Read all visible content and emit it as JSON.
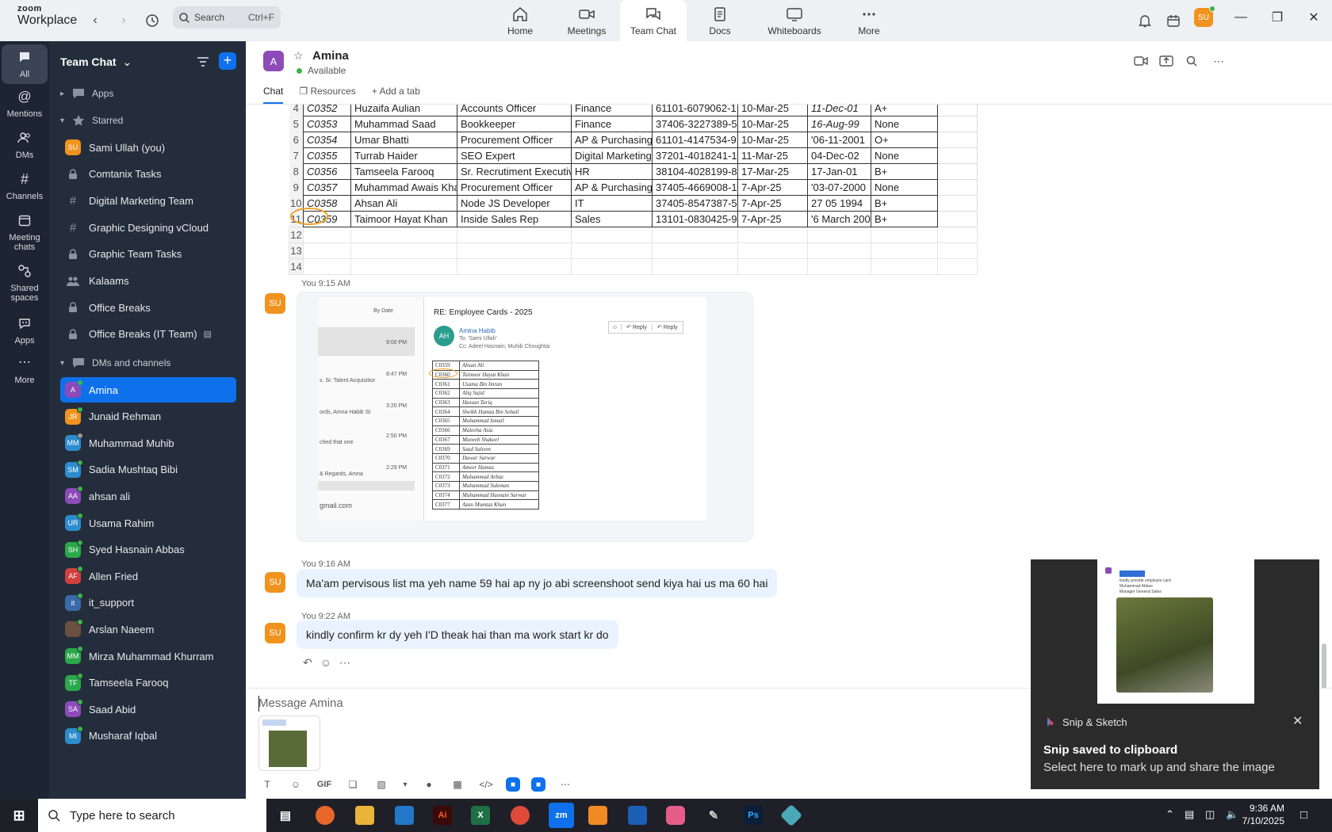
{
  "app": {
    "brand_top": "zoom",
    "brand_bottom": "Workplace"
  },
  "search": {
    "label": "Search",
    "shortcut": "Ctrl+F"
  },
  "nav": [
    {
      "label": "Home"
    },
    {
      "label": "Meetings"
    },
    {
      "label": "Team Chat"
    },
    {
      "label": "Docs"
    },
    {
      "label": "Whiteboards"
    },
    {
      "label": "More"
    }
  ],
  "user": {
    "initials": "SU"
  },
  "rail": [
    {
      "label": "All"
    },
    {
      "label": "Mentions"
    },
    {
      "label": "DMs"
    },
    {
      "label": "Channels"
    },
    {
      "label": "Meeting chats"
    },
    {
      "label": "Shared spaces"
    },
    {
      "label": "Apps"
    },
    {
      "label": "More"
    }
  ],
  "sidebar": {
    "title": "Team Chat",
    "apps_label": "Apps",
    "starred_label": "Starred",
    "dms_label": "DMs and channels",
    "starred": [
      {
        "label": "Sami Ullah (you)",
        "initials": "SU",
        "color": "#f0931e"
      },
      {
        "label": "Comtanix Tasks",
        "icon": "lock"
      },
      {
        "label": "Digital Marketing Team",
        "icon": "#"
      },
      {
        "label": "Graphic Designing vCloud",
        "icon": "#"
      },
      {
        "label": "Graphic Team Tasks",
        "icon": "lock"
      },
      {
        "label": "Kalaams",
        "icon": "group"
      },
      {
        "label": "Office Breaks",
        "icon": "lock"
      },
      {
        "label": "Office Breaks (IT Team)",
        "icon": "lock"
      }
    ],
    "dms": [
      {
        "label": "Amina",
        "initials": "A",
        "color": "#8c4bb8",
        "active": true
      },
      {
        "label": "Junaid Rehman",
        "initials": "JR",
        "color": "#f0931e"
      },
      {
        "label": "Muhammad Muhib",
        "initials": "MM",
        "color": "#2d8cce"
      },
      {
        "label": "Sadia Mushtaq Bibi",
        "initials": "SM",
        "color": "#2d8cce"
      },
      {
        "label": "ahsan ali",
        "initials": "AA",
        "color": "#8c4bb8"
      },
      {
        "label": "Usama Rahim",
        "initials": "UR",
        "color": "#2d8cce"
      },
      {
        "label": "Syed Hasnain Abbas",
        "initials": "SH",
        "color": "#2aa84a"
      },
      {
        "label": "Allen Fried",
        "initials": "AF",
        "color": "#d04040"
      },
      {
        "label": "it_support",
        "initials": "it",
        "color": "#3a6aa8"
      },
      {
        "label": "Arslan Naeem",
        "initials": "",
        "color": "#6b5040"
      },
      {
        "label": "Mirza Muhammad Khurram",
        "initials": "MM",
        "color": "#2aa84a"
      },
      {
        "label": "Tamseela Farooq",
        "initials": "TF",
        "color": "#2aa84a"
      },
      {
        "label": "Saad Abid",
        "initials": "SA",
        "color": "#8c4bb8"
      },
      {
        "label": "Musharaf Iqbal",
        "initials": "MI",
        "color": "#2d8cce"
      }
    ]
  },
  "channel": {
    "name": "Amina",
    "initial": "A",
    "status": "Available",
    "tabs": [
      "Chat",
      "Resources",
      "Add a tab"
    ]
  },
  "sheet": {
    "rows": [
      {
        "n": "4",
        "id": "C0352",
        "name": "Huzaifa Aulian",
        "title": "Accounts Officer",
        "dept": "Finance",
        "cnic": "61101-6079062-1",
        "join": "10-Mar-25",
        "dob": "11-Dec-01",
        "blood": "A+"
      },
      {
        "n": "5",
        "id": "C0353",
        "name": "Muhammad Saad",
        "title": "Bookkeeper",
        "dept": "Finance",
        "cnic": "37406-3227389-5",
        "join": "10-Mar-25",
        "dob": "16-Aug-99",
        "blood": "None"
      },
      {
        "n": "6",
        "id": "C0354",
        "name": "Umar Bhatti",
        "title": "Procurement Officer",
        "dept": "AP & Purchasing",
        "cnic": "61101-4147534-9",
        "join": "10-Mar-25",
        "dob": "'06-11-2001",
        "blood": "O+"
      },
      {
        "n": "7",
        "id": "C0355",
        "name": "Turrab Haider",
        "title": "SEO Expert",
        "dept": "Digital Marketing",
        "cnic": "37201-4018241-1",
        "join": "11-Mar-25",
        "dob": "04-Dec-02",
        "blood": "None"
      },
      {
        "n": "8",
        "id": "C0356",
        "name": "Tamseela Farooq",
        "title": "Sr. Recrutiment Executiv",
        "dept": "HR",
        "cnic": "38104-4028199-8",
        "join": "17-Mar-25",
        "dob": "17-Jan-01",
        "blood": "B+"
      },
      {
        "n": "9",
        "id": "C0357",
        "name": "Muhammad Awais Kha",
        "title": "Procurement Officer",
        "dept": "AP & Purchasing",
        "cnic": "37405-4669008-1",
        "join": "7-Apr-25",
        "dob": "'03-07-2000",
        "blood": "None"
      },
      {
        "n": "10",
        "id": "C0358",
        "name": "Ahsan Ali",
        "title": "Node JS Developer",
        "dept": "IT",
        "cnic": "37405-8547387-5",
        "join": "7-Apr-25",
        "dob": "27 05 1994",
        "blood": "B+"
      },
      {
        "n": "11",
        "id": "C0359",
        "name": "Taimoor Hayat Khan",
        "title": "Inside Sales Rep",
        "dept": "Sales",
        "cnic": "13101-0830425-9",
        "join": "7-Apr-25",
        "dob": "'6 March 2001",
        "blood": "B+"
      }
    ],
    "empty_rows": [
      "12",
      "13",
      "14"
    ]
  },
  "messages": [
    {
      "meta": "You 9:15 AM",
      "initials": "SU",
      "kind": "image"
    },
    {
      "meta": "You 9:16 AM",
      "initials": "SU",
      "text": "Ma'am pervisous list ma yeh name 59 hai ap ny jo abi screenshoot send kiya hai us ma 60 hai"
    },
    {
      "meta": "You 9:22 AM",
      "initials": "SU",
      "text": "kindly confirm kr dy yeh I'D theak hai than ma work start kr do"
    }
  ],
  "email_shot": {
    "sort": "By Date",
    "subject": "RE: Employee Cards - 2025",
    "from": "Amina Habib",
    "avatar": "AH",
    "to": "To: 'Sami Ullah'",
    "cc": "Cc: Adeel Hasnain; Muhib Choughtai",
    "reply": "Reply",
    "reply2": "Reply",
    "list_times": [
      "9:00 PM",
      "8:47 PM",
      "3:20 PM",
      "2:50 PM",
      "2:29 PM"
    ],
    "list_snips": [
      "s. Sr. Talent Acquisitior",
      "ords, Amna Habib St",
      "ched that one",
      "& Regards, Amna",
      "gmail.com"
    ],
    "rows": [
      [
        "C0359",
        "Ahsan Ali"
      ],
      [
        "C0360",
        "Taimoor Hayat Khan"
      ],
      [
        "C0361",
        "Usama Bin Imran"
      ],
      [
        "C0362",
        "Aliq Sajid"
      ],
      [
        "C0363",
        "Hassan Tariq"
      ],
      [
        "C0364",
        "Sheikh Hamza Bin Sohail"
      ],
      [
        "C0365",
        "Muhammad Ismail"
      ],
      [
        "C0366",
        "Maleeha Asia"
      ],
      [
        "C0367",
        "Muneeb Shakeel"
      ],
      [
        "C0369",
        "Saad Saleem"
      ],
      [
        "C0370",
        "Dawar Sarwar"
      ],
      [
        "C0371",
        "Ameer Hamza"
      ],
      [
        "C0372",
        "Muhammad Arbaz"
      ],
      [
        "C0373",
        "Muhammad Suleman"
      ],
      [
        "C0374",
        "Muhammad Husnain Sarwar"
      ],
      [
        "C0377",
        "Azan Mumtaz Khan"
      ]
    ]
  },
  "composer": {
    "placeholder": "Message Amina",
    "gif": "GIF"
  },
  "toast": {
    "app": "Snip & Sketch",
    "title": "Snip saved to clipboard",
    "subtitle": "Select here to mark up and share the image",
    "preview_caption": "kindly provide employee card",
    "preview_lines": [
      "Muhammad Abbas",
      "Manager General Sales"
    ]
  },
  "taskbar": {
    "search_placeholder": "Type here to search",
    "time": "9:36 AM",
    "date": "7/10/2025",
    "apps": [
      "Ai",
      "X",
      "Ps"
    ]
  }
}
